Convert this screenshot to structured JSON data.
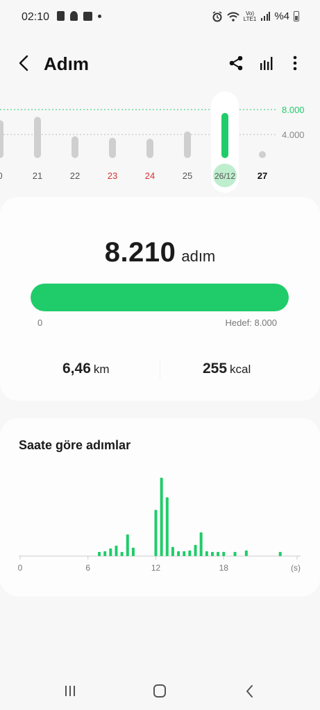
{
  "status_bar": {
    "time": "02:10",
    "lte_label": "Vo)",
    "lte_label2": "LTE1",
    "battery_text": "%4",
    "icons": [
      "sim-icon",
      "notification-icon",
      "box-icon",
      "dot-icon",
      "alarm-icon",
      "wifi-icon",
      "volte-icon",
      "signal-icon",
      "battery-icon"
    ]
  },
  "header": {
    "title": "Adım",
    "icons": [
      "back-arrow-icon",
      "share-icon",
      "bar-chart-icon",
      "more-vert-icon"
    ]
  },
  "daily_chart": {
    "goal_label": "8.000",
    "mid_label": "4.000",
    "days": [
      "0",
      "21",
      "22",
      "23",
      "24",
      "25",
      "26/12",
      "27"
    ],
    "day_colors": [
      "#555555",
      "#555555",
      "#555555",
      "#d33333",
      "#d33333",
      "#555555",
      "#555555",
      "#111111"
    ],
    "bar_fractions": [
      0.78,
      0.85,
      0.45,
      0.42,
      0.4,
      0.55,
      0.93,
      0.0
    ],
    "selected_index": 6,
    "accent": "#20cc6a"
  },
  "summary": {
    "steps": "8.210",
    "steps_unit": "adım",
    "progress_fraction": 1.0,
    "min_label": "0",
    "goal_label": "Hedef: 8.000",
    "distance_value": "6,46",
    "distance_unit": "km",
    "calories_value": "255",
    "calories_unit": "kcal"
  },
  "hourly": {
    "title": "Saate göre adımlar",
    "x_labels": [
      "0",
      "6",
      "12",
      "18",
      "(s)"
    ],
    "bars": [
      {
        "hour": 7.0,
        "value": 6
      },
      {
        "hour": 7.5,
        "value": 7
      },
      {
        "hour": 8.0,
        "value": 11
      },
      {
        "hour": 8.5,
        "value": 15
      },
      {
        "hour": 9.0,
        "value": 6
      },
      {
        "hour": 9.5,
        "value": 31
      },
      {
        "hour": 10.0,
        "value": 12
      },
      {
        "hour": 12.0,
        "value": 66
      },
      {
        "hour": 12.5,
        "value": 112
      },
      {
        "hour": 13.0,
        "value": 84
      },
      {
        "hour": 13.5,
        "value": 13
      },
      {
        "hour": 14.0,
        "value": 7
      },
      {
        "hour": 14.5,
        "value": 7
      },
      {
        "hour": 15.0,
        "value": 8
      },
      {
        "hour": 15.5,
        "value": 16
      },
      {
        "hour": 16.0,
        "value": 34
      },
      {
        "hour": 16.5,
        "value": 7
      },
      {
        "hour": 17.0,
        "value": 6
      },
      {
        "hour": 17.5,
        "value": 6
      },
      {
        "hour": 18.0,
        "value": 6
      },
      {
        "hour": 19.0,
        "value": 6
      },
      {
        "hour": 20.0,
        "value": 8
      },
      {
        "hour": 23.0,
        "value": 6
      }
    ]
  },
  "nav": {
    "icons": [
      "recent-apps-icon",
      "home-icon",
      "back-icon"
    ]
  }
}
